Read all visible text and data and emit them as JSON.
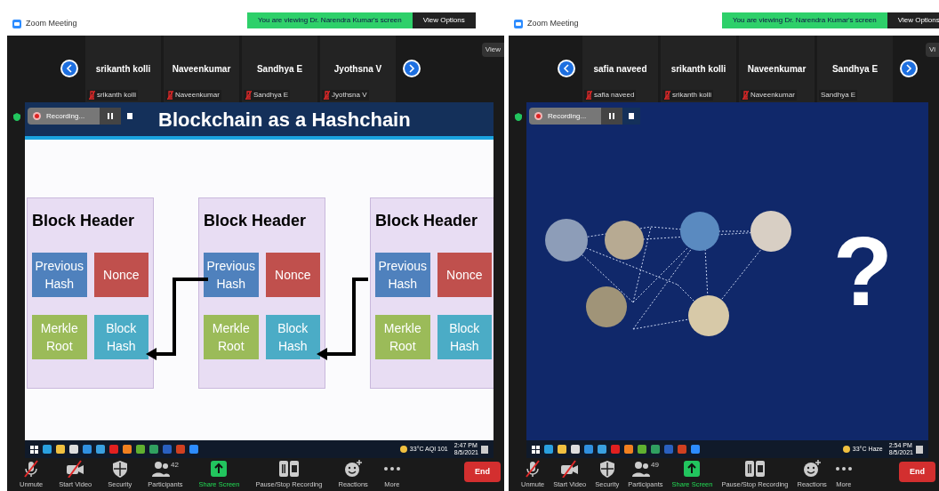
{
  "windows": [
    {
      "title": "Zoom Meeting",
      "banner": "You are viewing Dr. Narendra Kumar's screen",
      "view_options": "View Options",
      "view_button": "View",
      "participants": [
        {
          "name": "srikanth kolli",
          "label": "srikanth kolli",
          "muted": true
        },
        {
          "name": "Naveenkumar",
          "label": "Naveenkumar",
          "muted": true
        },
        {
          "name": "Sandhya E",
          "label": "Sandhya E",
          "muted": true
        },
        {
          "name": "Jyothsna V",
          "label": "Jyothsna V",
          "muted": true
        }
      ],
      "recording": "Recording...",
      "content": {
        "kind": "slide",
        "title": "Blockchain as a Hashchain",
        "blocks": [
          {
            "header": "Block Header",
            "cells": [
              {
                "text": "Previous Hash",
                "color": "#4f81bd"
              },
              {
                "text": "Nonce",
                "color": "#c0504d"
              },
              {
                "text": "Merkle Root",
                "color": "#9bbb59"
              },
              {
                "text": "Block Hash",
                "color": "#4bacc6"
              }
            ]
          },
          {
            "header": "Block Header",
            "cells": [
              {
                "text": "Previous Hash",
                "color": "#4f81bd"
              },
              {
                "text": "Nonce",
                "color": "#c0504d"
              },
              {
                "text": "Merkle Root",
                "color": "#9bbb59"
              },
              {
                "text": "Block Hash",
                "color": "#4bacc6"
              }
            ]
          },
          {
            "header": "Block Header",
            "cells": [
              {
                "text": "Previous Hash",
                "color": "#4f81bd"
              },
              {
                "text": "Nonce",
                "color": "#c0504d"
              },
              {
                "text": "Merkle Root",
                "color": "#9bbb59"
              },
              {
                "text": "Block Hash",
                "color": "#4bacc6"
              }
            ]
          }
        ]
      },
      "taskbar": {
        "weather": "33°C AQI 101",
        "time": "2:47 PM",
        "date": "8/5/2021"
      },
      "toolbar": [
        {
          "kind": "mic",
          "label": "Unmute"
        },
        {
          "kind": "video",
          "label": "Start Video"
        },
        {
          "kind": "security",
          "label": "Security"
        },
        {
          "kind": "participants",
          "label": "Participants",
          "count": "42"
        },
        {
          "kind": "share",
          "label": "Share Screen"
        },
        {
          "kind": "record",
          "label": "Pause/Stop Recording"
        },
        {
          "kind": "reactions",
          "label": "Reactions"
        },
        {
          "kind": "more",
          "label": "More"
        }
      ],
      "end": "End"
    },
    {
      "title": "Zoom Meeting",
      "banner": "You are viewing Dr. Narendra Kumar's screen",
      "view_options": "View Options",
      "view_button": "Vi",
      "participants": [
        {
          "name": "safia naveed",
          "label": "safia naveed",
          "muted": true
        },
        {
          "name": "srikanth kolli",
          "label": "srikanth kolli",
          "muted": true
        },
        {
          "name": "Naveenkumar",
          "label": "Naveenkumar",
          "muted": true
        },
        {
          "name": "Sandhya E",
          "label": "Sandhya E",
          "muted": false
        }
      ],
      "recording": "Recording...",
      "content": {
        "kind": "photo",
        "mark": "?"
      },
      "taskbar": {
        "weather": "33°C Haze",
        "time": "2:54 PM",
        "date": "8/5/2021"
      },
      "toolbar": [
        {
          "kind": "mic",
          "label": "Unmute"
        },
        {
          "kind": "video",
          "label": "Start Video"
        },
        {
          "kind": "security",
          "label": "Security"
        },
        {
          "kind": "participants",
          "label": "Participants",
          "count": "49"
        },
        {
          "kind": "share",
          "label": "Share Screen"
        },
        {
          "kind": "record",
          "label": "Pause/Stop Recording"
        },
        {
          "kind": "reactions",
          "label": "Reactions"
        },
        {
          "kind": "more",
          "label": "More"
        }
      ],
      "end": "End"
    }
  ]
}
